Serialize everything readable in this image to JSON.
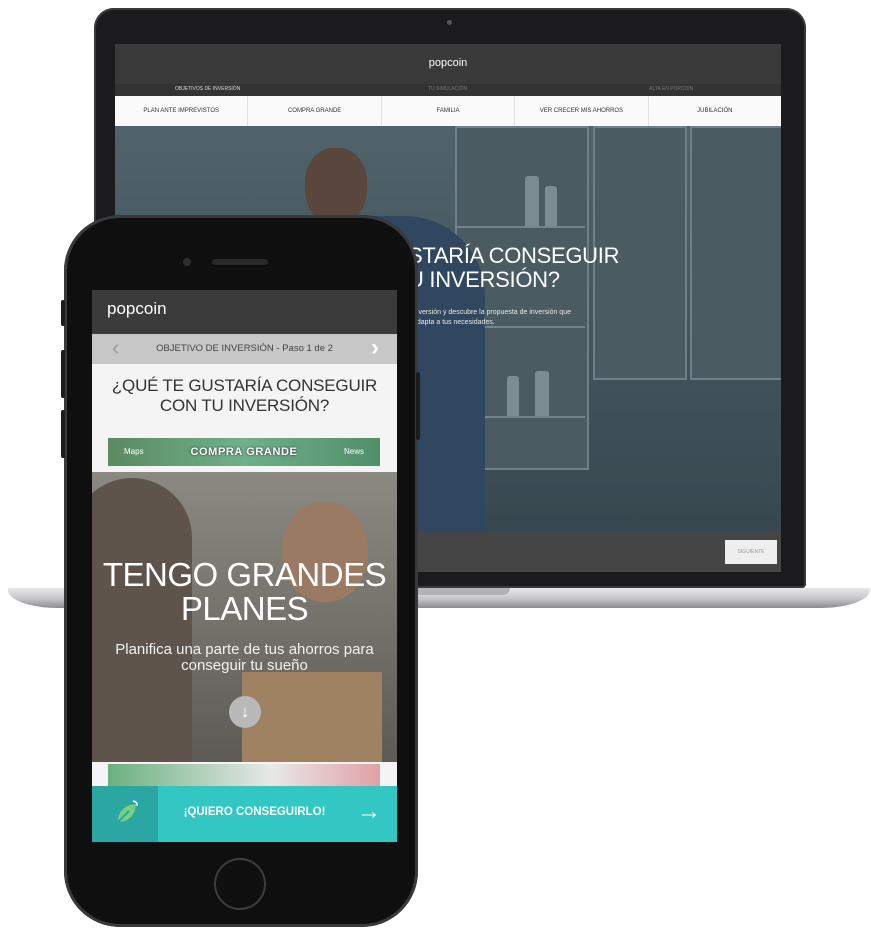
{
  "laptop": {
    "logo": "popcoin",
    "steps": [
      "OBJETIVOS DE INVERSIÓN",
      "TU SIMULACIÓN",
      "ALTA EN POPCOIN"
    ],
    "menu": [
      "PLAN ANTE IMPREVISTOS",
      "COMPRA GRANDE",
      "FAMILIA",
      "VER CRECER MIS AHORROS",
      "JUBILACIÓN"
    ],
    "hero_title_line1": "STARÍA CONSEGUIR",
    "hero_title_line2": "U INVERSIÓN?",
    "hero_sub_line1": "inversión y descubre la propuesta de inversión que",
    "hero_sub_line2": "adapta a tus necesidades.",
    "next_button": "SIGUIENTE"
  },
  "phone": {
    "logo": "popcoin",
    "nav": {
      "prev": "‹",
      "label": "OBJETIVO DE INVERSIÓN - Paso 1 de 2",
      "next": "›"
    },
    "title_line1": "¿QUÉ TE GUSTARÍA CONSEGUIR",
    "title_line2": "CON TU INVERSIÓN?",
    "category": {
      "left": "Maps",
      "label": "COMPRA GRANDE",
      "right": "News"
    },
    "card": {
      "title_line1": "TENGO GRANDES",
      "title_line2": "PLANES",
      "text": "Planifica una parte de tus ahorros para conseguir tu sueño",
      "down_icon": "↓"
    },
    "cta": {
      "label": "¡QUIERO CONSEGUIRLO!",
      "arrow": "→",
      "icon": "leaf-icon"
    }
  },
  "colors": {
    "accent": "#32c7c2",
    "accent_dark": "#2aa7a3",
    "header": "#3b3b3b"
  }
}
